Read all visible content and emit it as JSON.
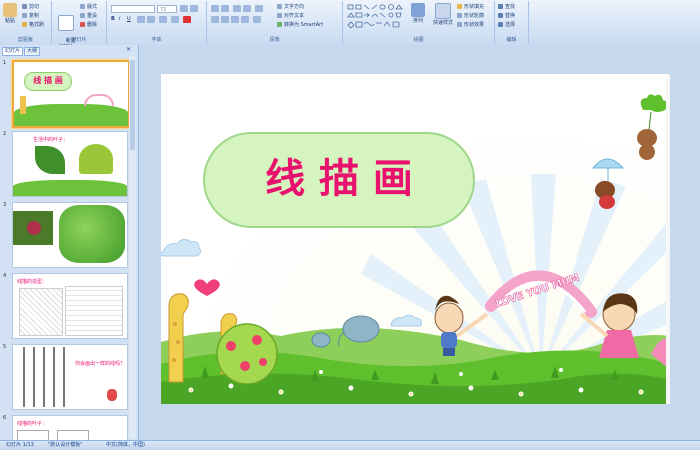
{
  "ribbon": {
    "groups": {
      "clipboard": {
        "label": "剪贴板",
        "paste": "粘贴",
        "cut": "剪切",
        "copy": "复制",
        "format_painter": "格式刷"
      },
      "slides": {
        "label": "幻灯片",
        "new_slide": "新建\n幻灯片",
        "layout": "版式",
        "reset": "重设",
        "delete": "删除"
      },
      "font": {
        "label": "字体",
        "font_size": "72"
      },
      "paragraph": {
        "label": "段落",
        "text_direction": "文字方向",
        "align_text": "对齐文本",
        "smartart": "转换为 SmartArt"
      },
      "drawing": {
        "label": "绘图",
        "arrange": "排列",
        "quick_styles": "快速样式",
        "shape_fill": "形状填充",
        "shape_outline": "形状轮廓",
        "shape_effects": "形状效果"
      },
      "editing": {
        "label": "编辑",
        "find": "查找",
        "replace": "替换",
        "select": "选择"
      }
    }
  },
  "panel": {
    "tabs": [
      "幻灯片",
      "大纲"
    ],
    "slides": [
      {
        "num": "1",
        "title": "线 描 画"
      },
      {
        "num": "2",
        "title": "生活中的叶子："
      },
      {
        "num": "3",
        "title": ""
      },
      {
        "num": "4",
        "title": "线描的造型："
      },
      {
        "num": "5",
        "title": "你会画出一样的线吗？"
      },
      {
        "num": "6",
        "title": "线描的叶子："
      }
    ]
  },
  "slide": {
    "title": "线 描 画",
    "rainbow_text": "LOVE YOU MUM"
  },
  "status": {
    "slide_counter": "幻灯片 1/13",
    "theme": "\"默认设计模板\"",
    "language": "中文(简体，中国)"
  },
  "colors": {
    "title_pink": "#e8126e",
    "title_bubble": "#d6f4bf",
    "grass": "#5fbf2c"
  }
}
